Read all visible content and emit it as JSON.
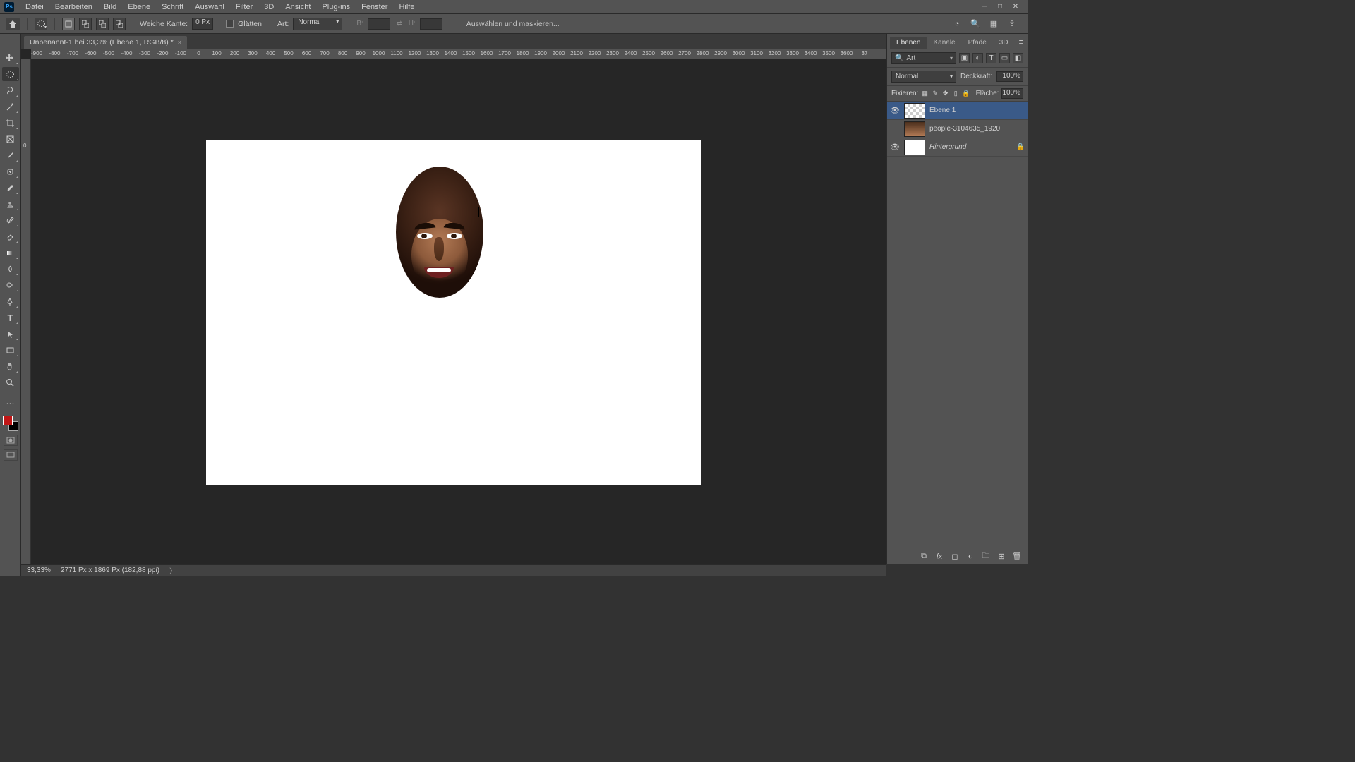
{
  "menu": {
    "items": [
      "Datei",
      "Bearbeiten",
      "Bild",
      "Ebene",
      "Schrift",
      "Auswahl",
      "Filter",
      "3D",
      "Ansicht",
      "Plug-ins",
      "Fenster",
      "Hilfe"
    ]
  },
  "options": {
    "featherLabel": "Weiche Kante:",
    "featherValue": "0 Px",
    "antialias": "Glätten",
    "styleLabel": "Art:",
    "styleValue": "Normal",
    "widthLabel": "B:",
    "heightLabel": "H:",
    "selectMask": "Auswählen und maskieren..."
  },
  "tab": {
    "title": "Unbenannt-1 bei 33,3% (Ebene 1, RGB/8) *"
  },
  "rulerH": [
    "-900",
    "-800",
    "-700",
    "-600",
    "-500",
    "-400",
    "-300",
    "-200",
    "-100",
    "0",
    "100",
    "200",
    "300",
    "400",
    "500",
    "600",
    "700",
    "800",
    "900",
    "1000",
    "1100",
    "1200",
    "1300",
    "1400",
    "1500",
    "1600",
    "1700",
    "1800",
    "1900",
    "2000",
    "2100",
    "2200",
    "2300",
    "2400",
    "2500",
    "2600",
    "2700",
    "2800",
    "2900",
    "3000",
    "3100",
    "3200",
    "3300",
    "3400",
    "3500",
    "3600",
    "37"
  ],
  "rulerV": [
    "0"
  ],
  "panel": {
    "tabs": [
      "Ebenen",
      "Kanäle",
      "Pfade",
      "3D"
    ],
    "searchPlaceholder": "Art",
    "blendMode": "Normal",
    "opacityLabel": "Deckkraft:",
    "opacityVal": "100%",
    "lockLabel": "Fixieren:",
    "fillLabel": "Fläche:",
    "fillVal": "100%",
    "layers": [
      {
        "visible": true,
        "name": "Ebene 1",
        "sel": true,
        "thumb": "checker",
        "locked": false,
        "italic": false
      },
      {
        "visible": false,
        "name": "people-3104635_1920",
        "sel": false,
        "thumb": "photo",
        "locked": false,
        "italic": false
      },
      {
        "visible": true,
        "name": "Hintergrund",
        "sel": false,
        "thumb": "white",
        "locked": true,
        "italic": true
      }
    ]
  },
  "status": {
    "zoom": "33,33%",
    "docinfo": "2771 Px x 1869 Px (182,88 ppi)"
  }
}
